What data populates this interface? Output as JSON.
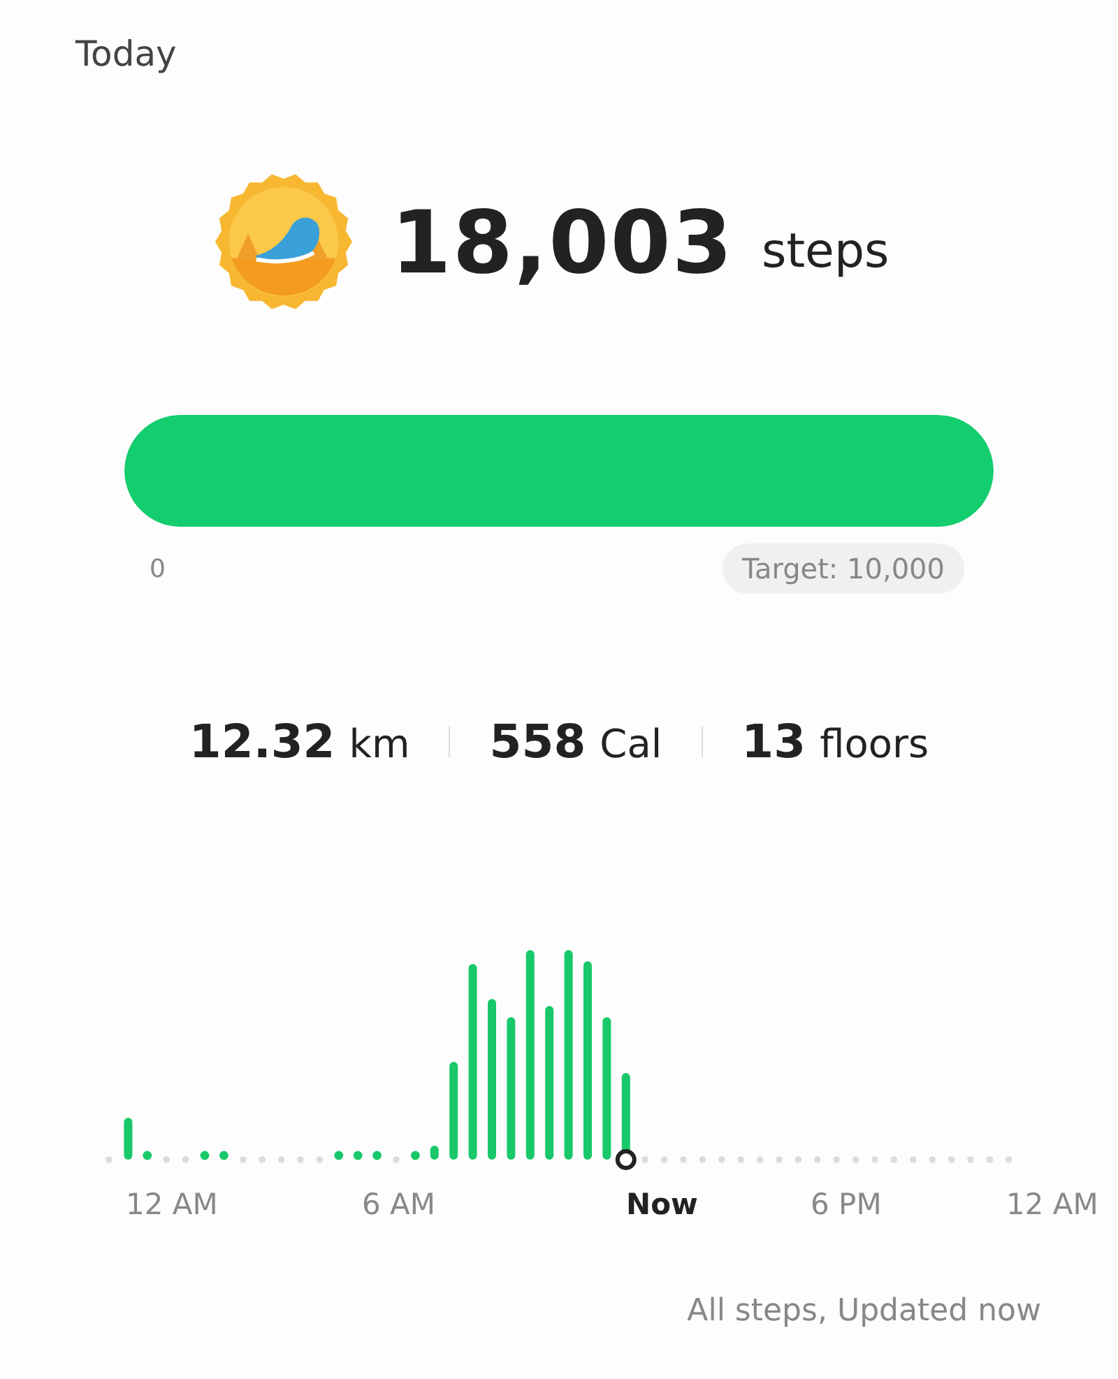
{
  "header": {
    "title": "Today"
  },
  "steps": {
    "count": "18,003",
    "unit": "steps"
  },
  "progress": {
    "level": 1,
    "start_label": "0",
    "target_label": "Target: 10,000"
  },
  "stats": [
    {
      "value": "12.32",
      "unit": "km"
    },
    {
      "value": "558",
      "unit": "Cal"
    },
    {
      "value": "13",
      "unit": "floors"
    }
  ],
  "chart": {
    "x_labels": [
      {
        "text": "12 AM",
        "selected": false
      },
      {
        "text": "6 AM",
        "selected": false
      },
      {
        "text": "Now",
        "selected": true
      },
      {
        "text": "6 PM",
        "selected": false
      },
      {
        "text": "12 AM",
        "selected": false
      }
    ]
  },
  "footer": {
    "text": "All steps, Updated now"
  }
}
